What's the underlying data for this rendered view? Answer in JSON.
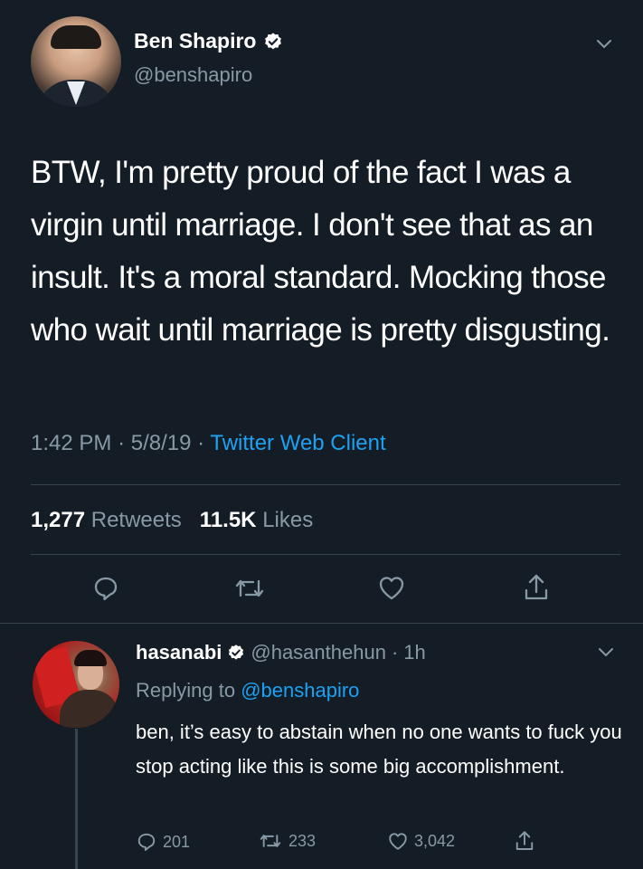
{
  "colors": {
    "background": "#141d26",
    "text": "#ffffff",
    "muted": "#8899a6",
    "link": "#1da1f2",
    "divider": "#38444d"
  },
  "main_tweet": {
    "display_name": "Ben Shapiro",
    "handle": "@benshapiro",
    "verified_icon": "verified-badge-icon",
    "text": "BTW, I'm pretty proud of the fact I was a virgin until marriage. I don't see that as an insult. It's a moral standard. Mocking those who wait until marriage is pretty disgusting.",
    "time": "1:42 PM",
    "date": "5/8/19",
    "separator": "·",
    "source": "Twitter Web Client",
    "retweet_count": "1,277",
    "retweet_label": "Retweets",
    "like_count": "11.5K",
    "like_label": "Likes",
    "actions": [
      "reply-icon",
      "retweet-icon",
      "like-icon",
      "share-icon"
    ]
  },
  "reply_tweet": {
    "display_name": "hasanabi",
    "handle": "@hasanthehun",
    "time_ago": "1h",
    "separator": "·",
    "replying_label": "Replying to",
    "replying_to": "@benshapiro",
    "text": "ben, it’s easy to abstain when no one wants to fuck you stop acting like this is some big accomplishment.",
    "reply_count": "201",
    "retweet_count": "233",
    "like_count": "3,042"
  }
}
